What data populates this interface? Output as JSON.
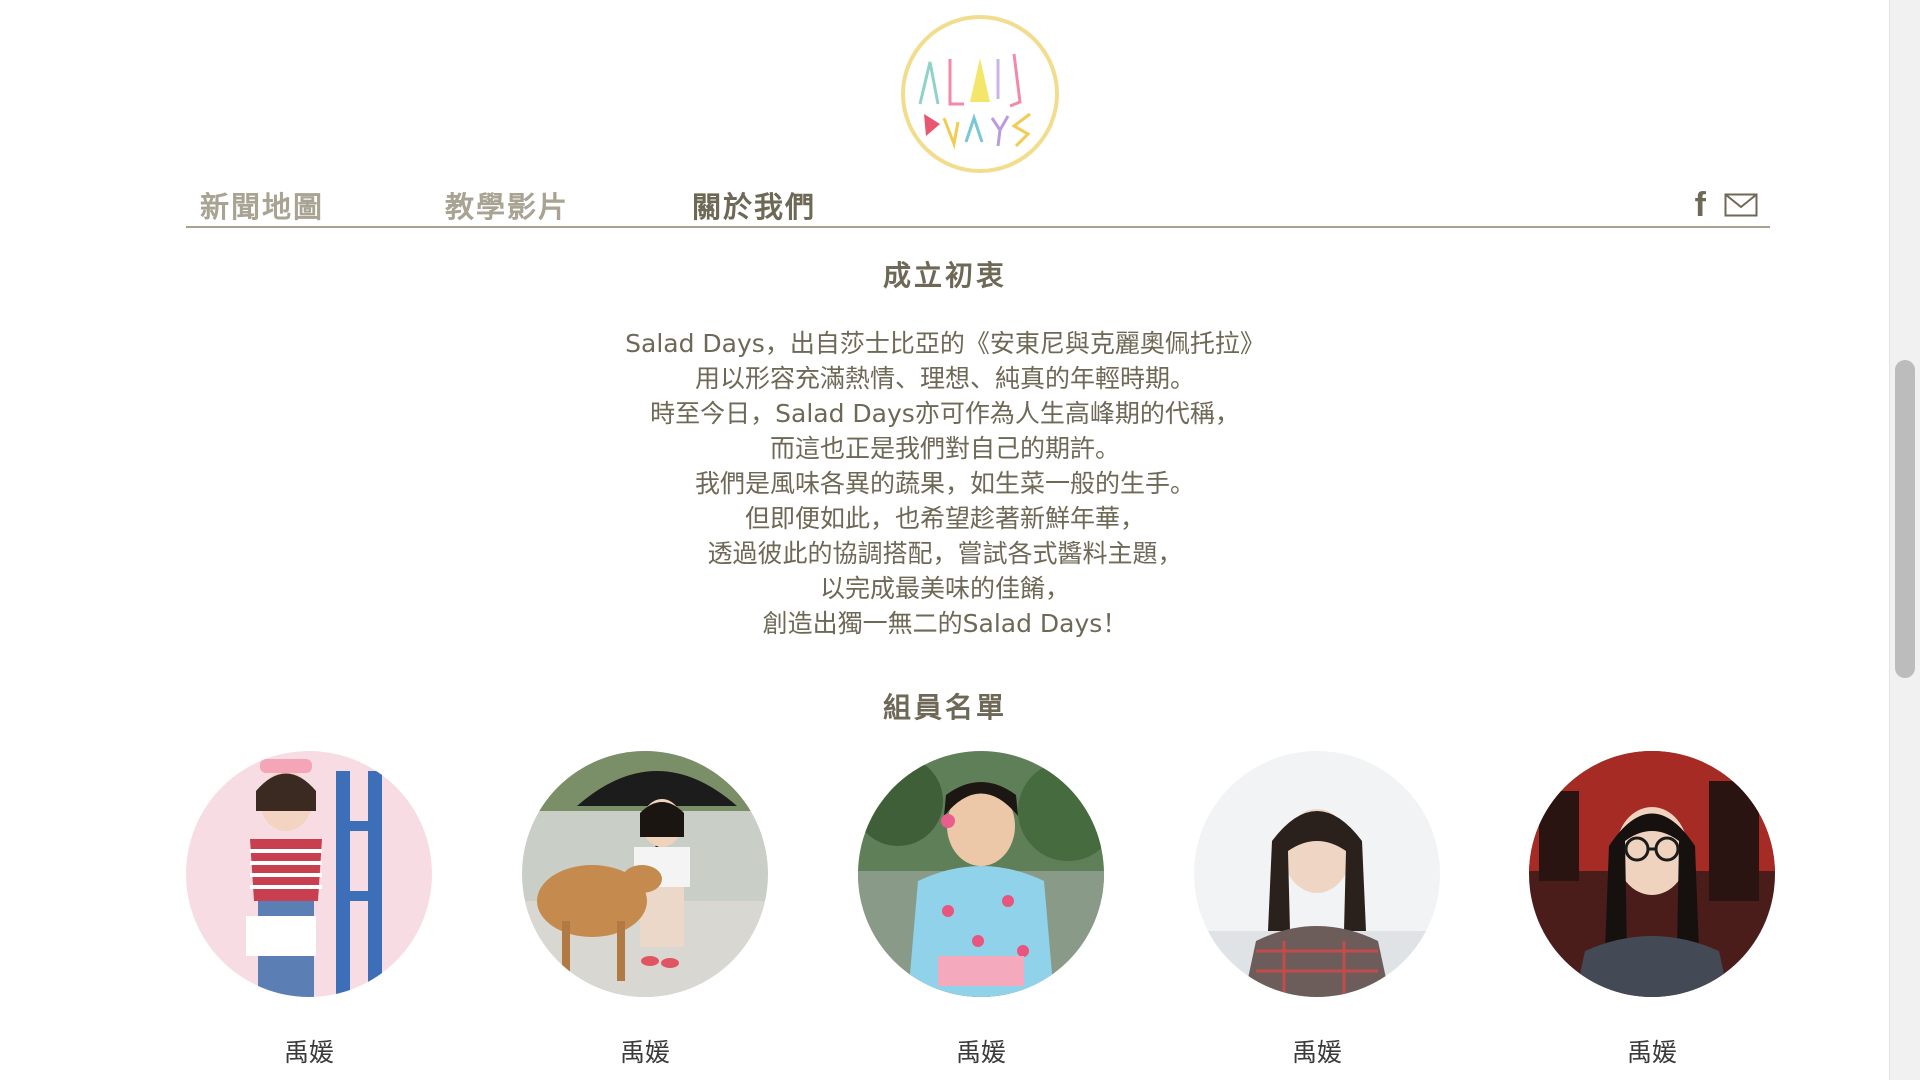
{
  "nav": {
    "items": [
      {
        "label": "新聞地圖",
        "active": false
      },
      {
        "label": "教學影片",
        "active": false
      },
      {
        "label": "關於我們",
        "active": true
      }
    ],
    "facebook_glyph": "f",
    "icons": [
      "facebook-icon",
      "mail-icon"
    ]
  },
  "about": {
    "title": "成立初衷",
    "lines": [
      "Salad Days，出自莎士比亞的《安東尼與克麗奧佩托拉》",
      "用以形容充滿熱情、理想、純真的年輕時期。",
      "時至今日，Salad Days亦可作為人生高峰期的代稱，",
      "而這也正是我們對自己的期許。",
      "我們是風味各異的蔬果，如生菜一般的生手。",
      "但即便如此，也希望趁著新鮮年華，",
      "透過彼此的協調搭配，嘗試各式醬料主題，",
      "以完成最美味的佳餚，",
      "創造出獨一無二的Salad Days！"
    ]
  },
  "members": {
    "title": "組員名單",
    "list": [
      {
        "name": "禹媛"
      },
      {
        "name": "禹媛"
      },
      {
        "name": "禹媛"
      },
      {
        "name": "禹媛"
      },
      {
        "name": "禹媛"
      }
    ]
  },
  "colors": {
    "text": "#6e6856",
    "nav_inactive": "#a9a393",
    "rule": "#a9a28e",
    "logo_ring": "#f2dd8e"
  }
}
